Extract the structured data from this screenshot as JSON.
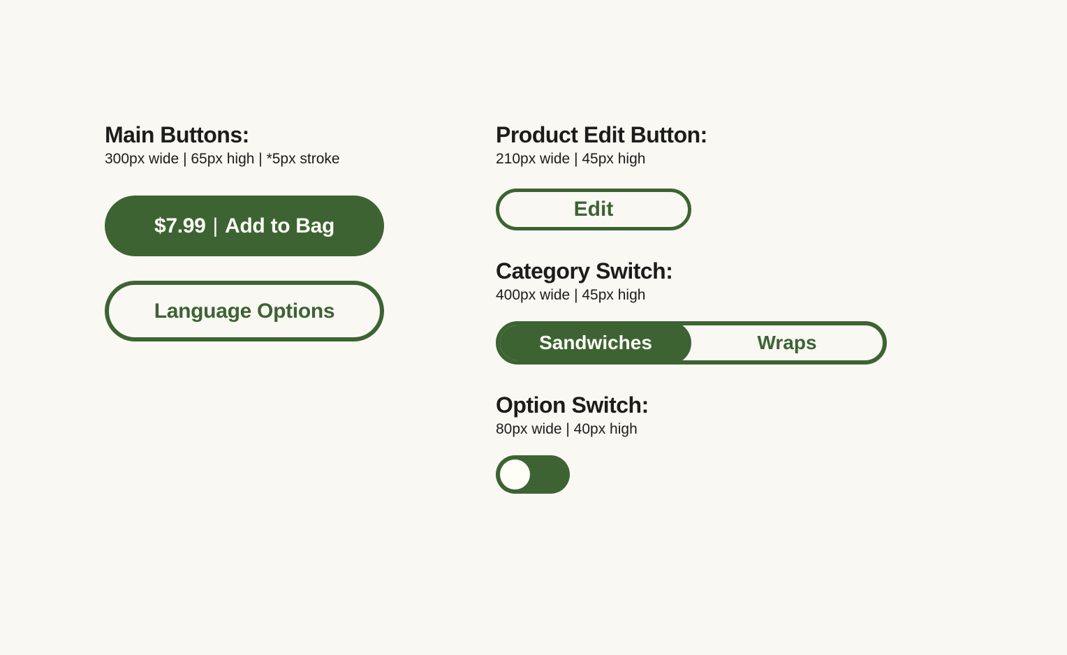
{
  "main_buttons": {
    "title": "Main Buttons:",
    "spec": "300px wide | 65px high | *5px stroke",
    "filled": {
      "price": "$7.99",
      "pipe": "|",
      "action": "Add to Bag"
    },
    "outline": {
      "label": "Language Options"
    }
  },
  "product_edit": {
    "title": "Product Edit Button:",
    "spec": "210px wide | 45px high",
    "label": "Edit"
  },
  "category_switch": {
    "title": "Category Switch:",
    "spec": "400px wide | 45px high",
    "options": [
      "Sandwiches",
      "Wraps"
    ],
    "active_index": 0
  },
  "option_switch": {
    "title": "Option Switch:",
    "spec": "80px wide | 40px high",
    "on": false
  },
  "colors": {
    "primary": "#3d6333",
    "bg": "#f9f8f3",
    "text": "#1c1c1a",
    "on_primary": "#fefdf6"
  }
}
